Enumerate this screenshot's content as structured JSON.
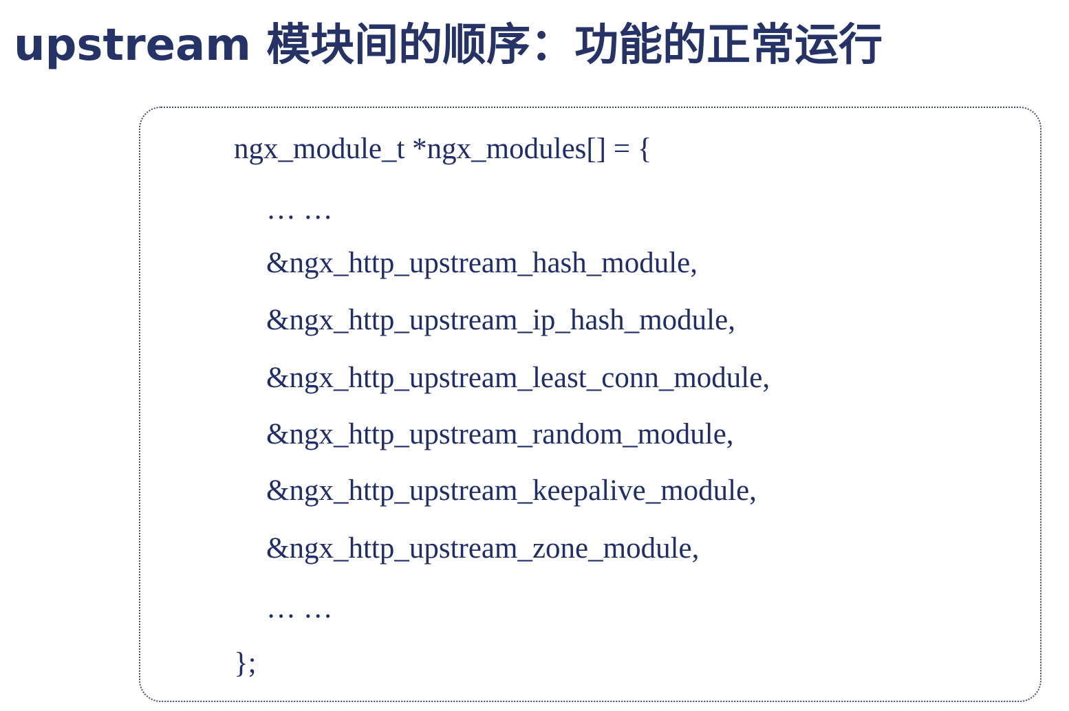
{
  "slide": {
    "title": "upstream 模块间的顺序：功能的正常运行"
  },
  "code": {
    "lines": [
      "ngx_module_t *ngx_modules[] = {",
      "… …",
      "&ngx_http_upstream_hash_module,",
      "&ngx_http_upstream_ip_hash_module,",
      "&ngx_http_upstream_least_conn_module,",
      "&ngx_http_upstream_random_module,",
      "&ngx_http_upstream_keepalive_module,",
      "&ngx_http_upstream_zone_module,",
      "… …",
      "};"
    ]
  },
  "colors": {
    "title": "#253366",
    "code_text": "#1f2d6b",
    "box_border": "#3a4a7a"
  }
}
